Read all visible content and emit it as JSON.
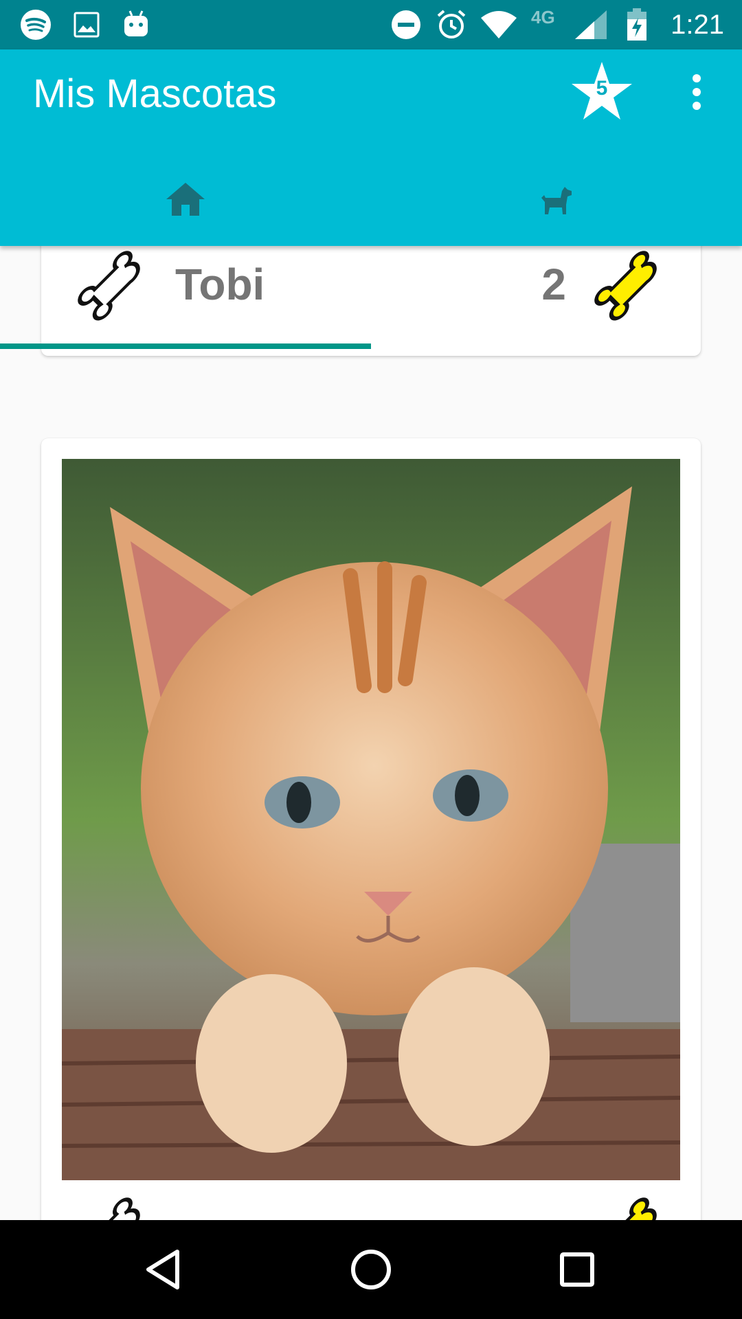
{
  "status_bar": {
    "time": "1:21",
    "network": "4G",
    "left_icons": [
      "spotify-icon",
      "image-icon",
      "android-icon"
    ],
    "right_icons": [
      "do-not-disturb-icon",
      "alarm-icon",
      "wifi-icon",
      "signal-icon",
      "battery-charging-icon"
    ]
  },
  "app_bar": {
    "title": "Mis Mascotas",
    "favorites_count": "5",
    "color": "#00bcd4",
    "status_color": "#00838f"
  },
  "tabs": [
    {
      "icon": "home-icon",
      "selected": true
    },
    {
      "icon": "dog-icon",
      "selected": false
    }
  ],
  "pets": [
    {
      "name": "Tobi",
      "rating": "2",
      "like_icon": "bone-outline-icon",
      "rating_icon": "bone-yellow-icon"
    },
    {
      "photo": "kitten-photo",
      "like_icon": "bone-outline-icon",
      "rating_icon": "bone-yellow-icon"
    }
  ],
  "nav_bar": {
    "buttons": [
      "back-icon",
      "home-circle-icon",
      "recents-icon"
    ]
  }
}
